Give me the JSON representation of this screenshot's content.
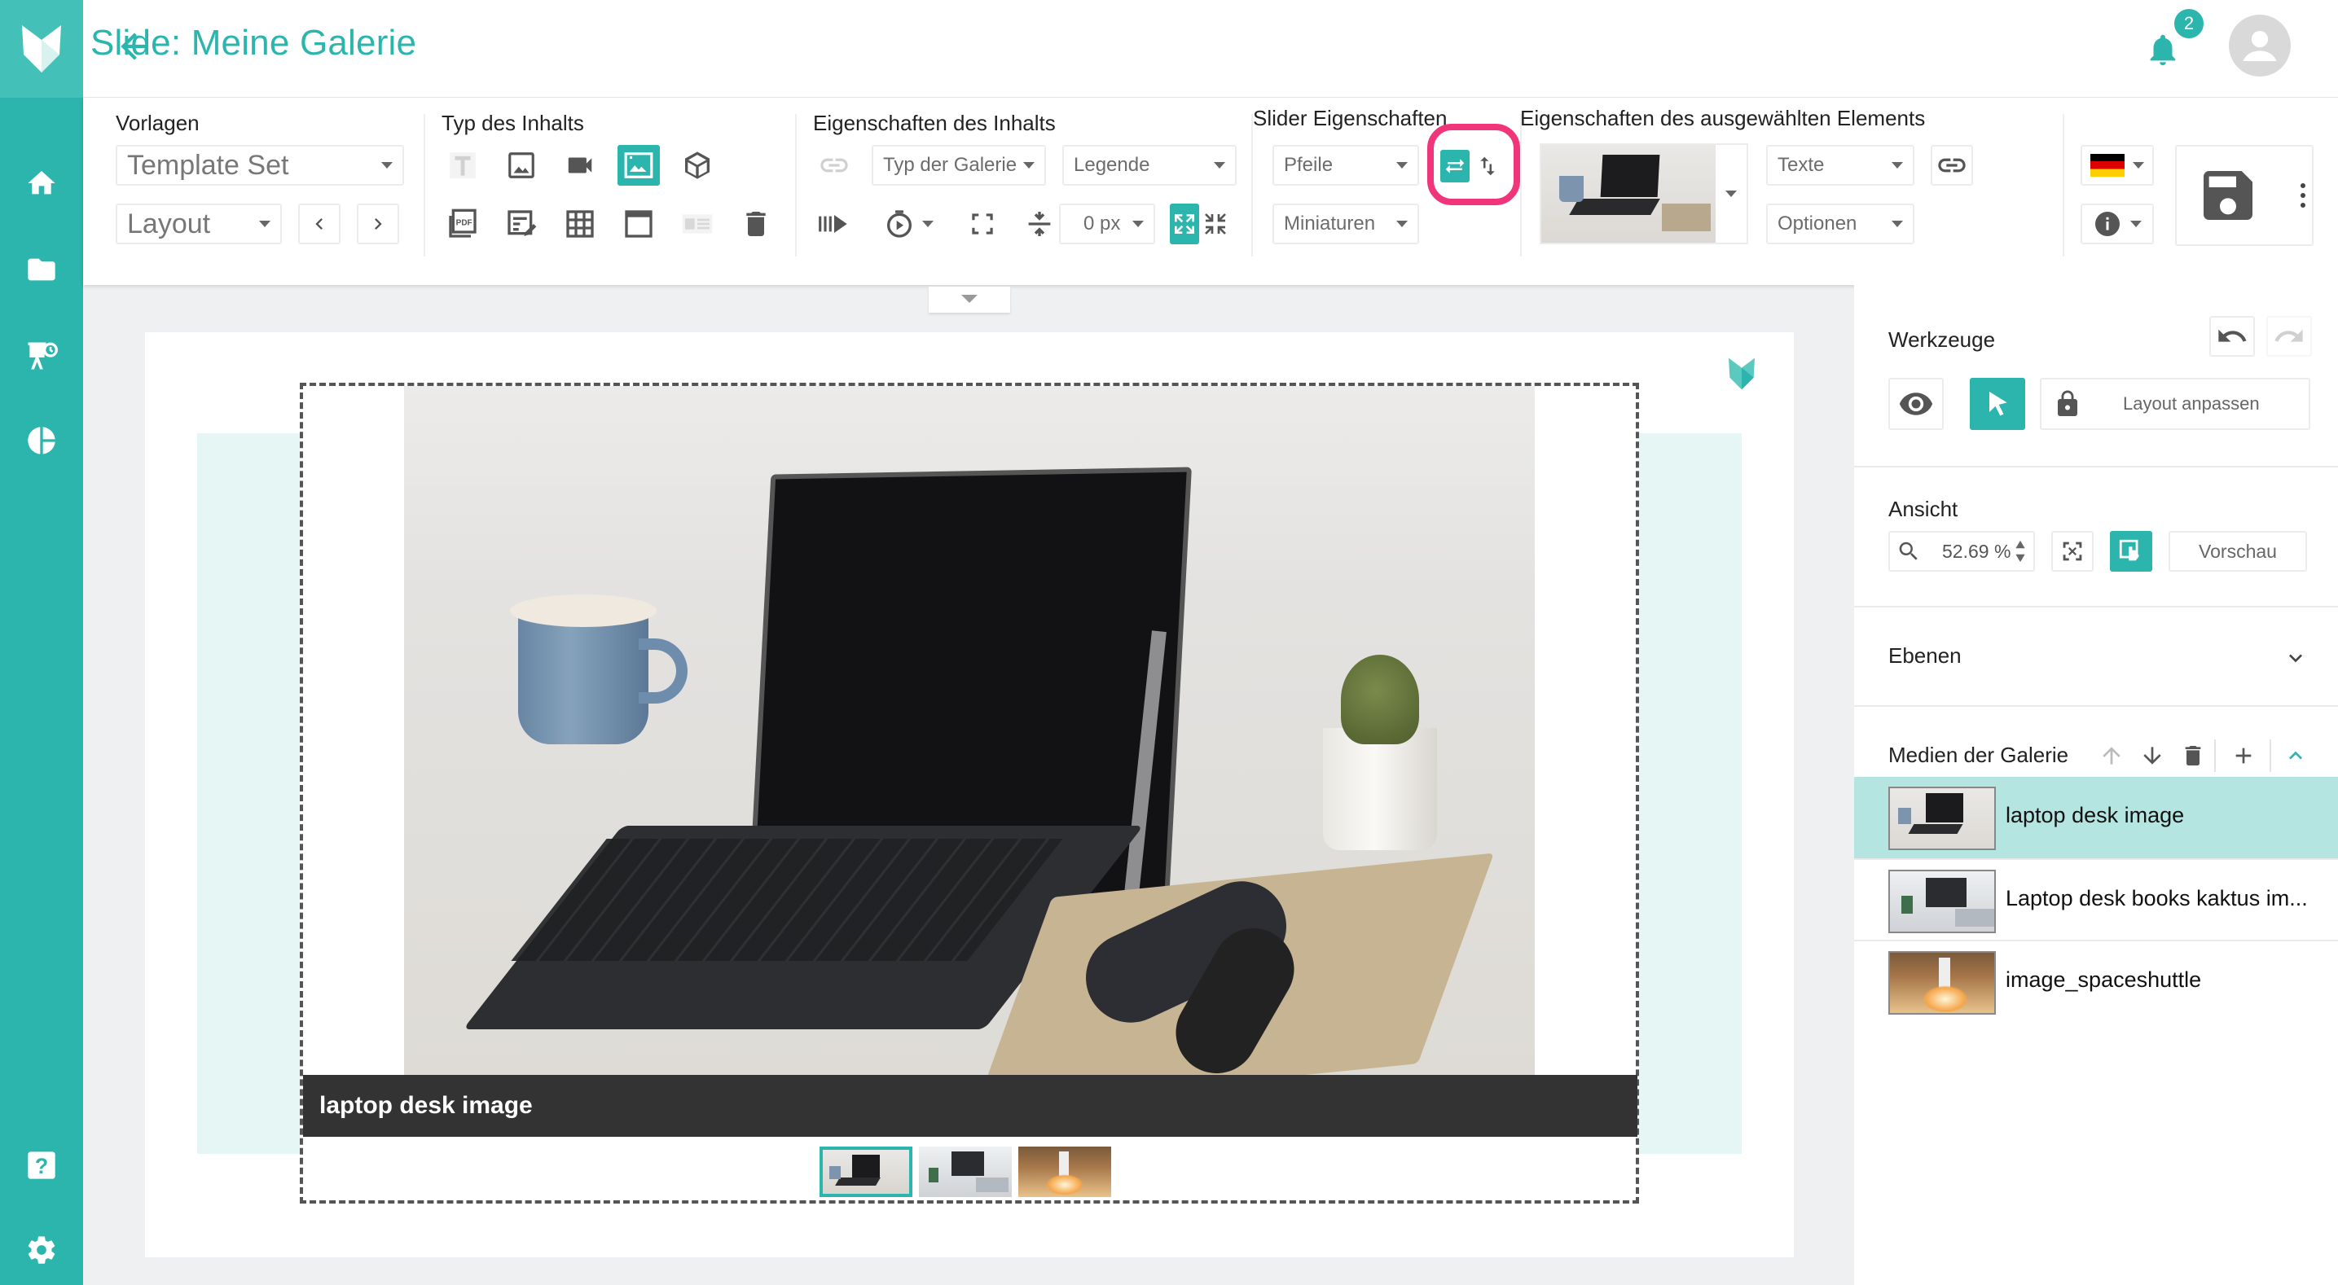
{
  "app": {
    "title": "Slide: Meine Galerie",
    "notification_count": "2"
  },
  "nav": {
    "items": [
      "home-icon",
      "folder-icon",
      "presentation-icon",
      "pie-chart-icon"
    ],
    "bottom": [
      "help-icon",
      "settings-icon"
    ]
  },
  "toolbar": {
    "vorlagen": {
      "label": "Vorlagen",
      "template_set": "Template Set",
      "layout": "Layout"
    },
    "typ": {
      "label": "Typ des Inhalts"
    },
    "eigenschaften": {
      "label": "Eigenschaften des Inhalts",
      "typ_galerie": "Typ der Galerie",
      "legende": "Legende",
      "spacing": "0 px"
    },
    "slider": {
      "label": "Slider Eigenschaften",
      "pfeile": "Pfeile",
      "miniaturen": "Miniaturen"
    },
    "element": {
      "label": "Eigenschaften des ausgewählten Elements",
      "texte": "Texte",
      "optionen": "Optionen"
    }
  },
  "canvas": {
    "caption": "laptop desk image"
  },
  "panel": {
    "werkzeuge": {
      "label": "Werkzeuge",
      "layout_button": "Layout anpassen"
    },
    "ansicht": {
      "label": "Ansicht",
      "zoom": "52.69 %",
      "preview_button": "Vorschau"
    },
    "ebenen": {
      "label": "Ebenen"
    },
    "medien": {
      "label": "Medien der Galerie",
      "items": [
        {
          "name": "laptop desk image",
          "selected": true
        },
        {
          "name": "Laptop desk books kaktus im...",
          "selected": false
        },
        {
          "name": "image_spaceshuttle",
          "selected": false
        }
      ]
    }
  },
  "colors": {
    "accent": "#2bb5ac",
    "highlight_ring": "#f0357a",
    "selected_row": "#b5e5e1"
  }
}
